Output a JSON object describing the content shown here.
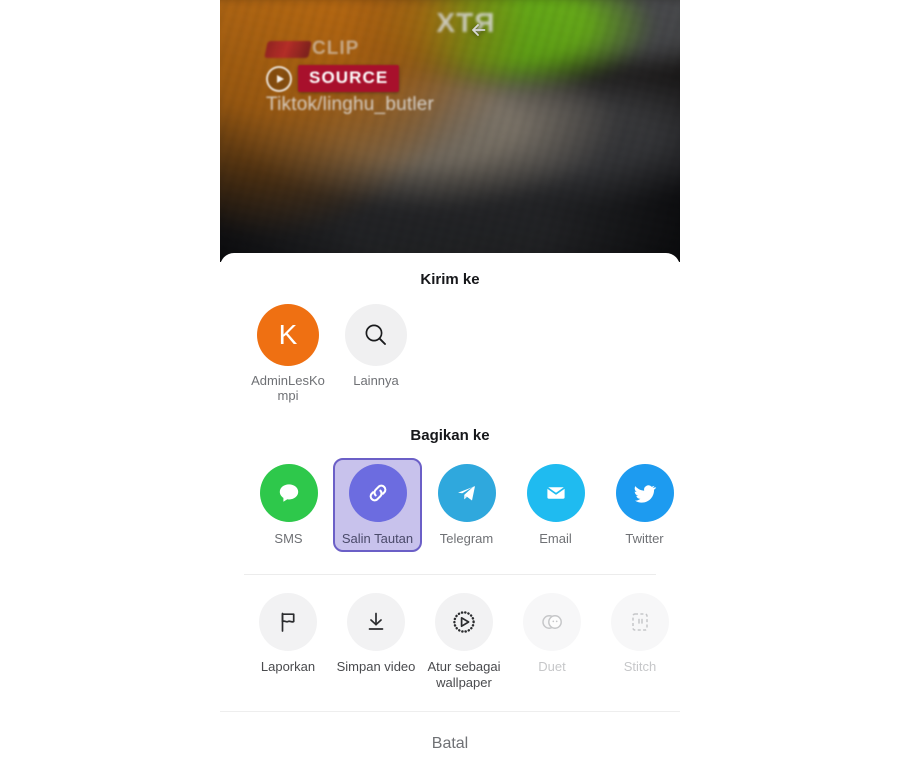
{
  "video": {
    "back_icon": "back-arrow-icon",
    "watermark_text": "CLIP",
    "source_badge": "SOURCE",
    "source_handle": "Tiktok/linghu_butler",
    "overlay_brand": "RTX"
  },
  "send_section": {
    "title": "Kirim ke",
    "items": [
      {
        "label": "AdminLesKompi",
        "icon": "avatar",
        "initial": "K",
        "color": "#ef7012"
      },
      {
        "label": "Lainnya",
        "icon": "search-icon",
        "color": "#f0f0f1"
      }
    ]
  },
  "share_section": {
    "title": "Bagikan ke",
    "items": [
      {
        "label": "SMS",
        "icon": "sms-icon",
        "color": "#2ec84b",
        "selected": false
      },
      {
        "label": "Salin Tautan",
        "icon": "link-icon",
        "color": "#6c6ce0",
        "selected": true
      },
      {
        "label": "Telegram",
        "icon": "telegram-icon",
        "color": "#2fa8dd",
        "selected": false
      },
      {
        "label": "Email",
        "icon": "email-icon",
        "color": "#1fbbf0",
        "selected": false
      },
      {
        "label": "Twitter",
        "icon": "twitter-icon",
        "color": "#1d9bf0",
        "selected": false
      },
      {
        "label": "",
        "icon": "facebook-icon",
        "color": "#4a9bf5",
        "selected": false
      }
    ]
  },
  "action_section": {
    "items": [
      {
        "label": "Laporkan",
        "icon": "flag-icon",
        "disabled": false
      },
      {
        "label": "Simpan video",
        "icon": "download-icon",
        "disabled": false
      },
      {
        "label": "Atur sebagai wallpaper",
        "icon": "wallpaper-play-icon",
        "disabled": false
      },
      {
        "label": "Duet",
        "icon": "duet-icon",
        "disabled": true
      },
      {
        "label": "Stitch",
        "icon": "stitch-icon",
        "disabled": true
      }
    ]
  },
  "cancel": {
    "label": "Batal"
  }
}
